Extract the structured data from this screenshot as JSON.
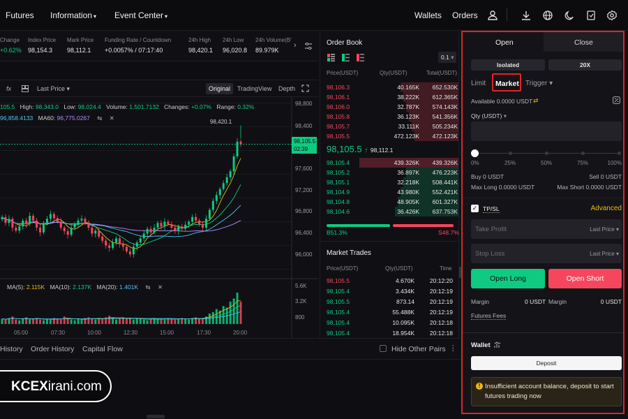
{
  "nav": {
    "futures": "Futures",
    "information": "Information",
    "event_center": "Event Center",
    "wallets": "Wallets",
    "orders": "Orders"
  },
  "ticker": {
    "change_label": "Change",
    "change_value": "+0.62%",
    "index_price_label": "Index Price",
    "index_price_value": "98,154.3",
    "mark_price_label": "Mark Price",
    "mark_price_value": "98,112.1",
    "funding_label": "Funding Rate / Countdown",
    "funding_value": "+0.0057% / 07:17:40",
    "high_label": "24h High",
    "high_value": "98,420.1",
    "low_label": "24h Low",
    "low_value": "96,020.8",
    "volume_label": "24h Volume(B'",
    "volume_value": "89.979K"
  },
  "chart_toolbar": {
    "last_price": "Last Price",
    "original": "Original",
    "tradingview": "TradingView",
    "depth": "Depth"
  },
  "chart_info": {
    "open_frag": "105.5",
    "high_label": "High:",
    "high": "98,343.0",
    "low_label": "Low:",
    "low": "98,024.4",
    "volume_label": "Volume:",
    "volume": "1,501.7132",
    "changes_label": "Changes:",
    "changes": "+0.07%",
    "range_label": "Range:",
    "range": "0.32%",
    "ma_frag": "96,858.4133",
    "ma60_label": "MA60:",
    "ma60": "96,775.0267",
    "peak_label": "98,420.1",
    "vol_ma5_label": "MA(5):",
    "vol_ma5": "2.115K",
    "vol_ma10_label": "MA(10):",
    "vol_ma10": "2.137K",
    "vol_ma20_label": "MA(20):",
    "vol_ma20": "1.401K",
    "current_price": "98,105.5",
    "countdown": "02:39"
  },
  "chart_data": {
    "type": "candlestick",
    "price_axis": [
      "98,800",
      "98,400",
      "98,000",
      "97,600",
      "97,200",
      "96,800",
      "96,400",
      "96,000"
    ],
    "volume_axis": [
      "5.6K",
      "3.2K",
      "800"
    ],
    "time_axis": [
      "05:00",
      "07:30",
      "10:00",
      "12:30",
      "15:00",
      "17:30",
      "20:00"
    ],
    "ylim": [
      95900,
      98900
    ],
    "close": [
      96880,
      96780,
      96850,
      96700,
      96650,
      96720,
      96820,
      96760,
      96900,
      96820,
      96700,
      96620,
      96780,
      96850,
      96930,
      96860,
      96800,
      96700,
      96640,
      96580,
      96700,
      96760,
      96820,
      96850,
      96780,
      96700,
      96600,
      96650,
      96550,
      96480,
      96400,
      96360,
      96450,
      96520,
      96420,
      96380,
      96300,
      96250,
      96380,
      96450,
      96520,
      96600,
      96680,
      96620,
      96700,
      96780,
      96720,
      96800,
      96760,
      96700,
      96650,
      96720,
      96680,
      96750,
      96800,
      96880,
      96820,
      96760,
      96700,
      96850,
      97000,
      97150,
      97250,
      97350,
      97450,
      97550,
      97650,
      97900,
      98150,
      98105
    ],
    "volume": [
      0.7,
      0.6,
      0.8,
      1.0,
      0.6,
      0.5,
      0.7,
      0.9,
      0.6,
      0.7,
      0.8,
      0.6,
      0.5,
      0.7,
      0.6,
      0.8,
      0.7,
      0.6,
      1.0,
      0.8,
      0.6,
      0.5,
      0.7,
      0.6,
      0.8,
      0.9,
      0.7,
      0.6,
      0.8,
      0.7,
      0.9,
      1.1,
      0.8,
      0.6,
      0.7,
      0.9,
      0.8,
      0.7,
      0.6,
      0.8,
      0.7,
      0.6,
      0.5,
      0.7,
      0.8,
      0.6,
      0.7,
      0.6,
      0.8,
      0.7,
      0.6,
      0.7,
      0.8,
      0.7,
      0.6,
      0.8,
      0.9,
      0.7,
      0.8,
      1.0,
      1.4,
      1.6,
      2.0,
      1.8,
      2.4,
      2.2,
      3.0,
      3.4,
      4.2,
      3.0
    ]
  },
  "order_book": {
    "title": "Order Book",
    "step": "0.1",
    "headers": [
      "Price(USDT)",
      "Qty(USDT)",
      "Total(USDT)"
    ],
    "asks": [
      {
        "price": "98,106.3",
        "qty": "40.165K",
        "total": "652.530K",
        "depth": 0.42
      },
      {
        "price": "98,106.1",
        "qty": "38.222K",
        "total": "612.365K",
        "depth": 0.4
      },
      {
        "price": "98,106.0",
        "qty": "32.787K",
        "total": "574.143K",
        "depth": 0.38
      },
      {
        "price": "98,105.8",
        "qty": "36.123K",
        "total": "541.356K",
        "depth": 0.36
      },
      {
        "price": "98,105.7",
        "qty": "33.111K",
        "total": "505.234K",
        "depth": 0.34
      },
      {
        "price": "98,105.5",
        "qty": "472.123K",
        "total": "472.123K",
        "depth": 0.32
      }
    ],
    "mid_price": "98,105.5",
    "mid_mark": "98,112.1",
    "bids": [
      {
        "price": "98,105.4",
        "qty": "439.326K",
        "total": "439.326K",
        "depth": 0.36
      },
      {
        "price": "98,105.2",
        "qty": "36.897K",
        "total": "476.223K",
        "depth": 0.38
      },
      {
        "price": "98,105.1",
        "qty": "32.218K",
        "total": "508.441K",
        "depth": 0.4
      },
      {
        "price": "98,104.9",
        "qty": "43.980K",
        "total": "552.421K",
        "depth": 0.42
      },
      {
        "price": "98,104.8",
        "qty": "48.905K",
        "total": "601.327K",
        "depth": 0.44
      },
      {
        "price": "98,104.6",
        "qty": "36.426K",
        "total": "637.753K",
        "depth": 0.46
      }
    ],
    "buy_ratio": "B51.3%",
    "sell_ratio": "S48.7%",
    "buy_fraction": 0.513
  },
  "market_trades": {
    "title": "Market Trades",
    "headers": [
      "Price(USDT)",
      "Qty(USDT)",
      "Time"
    ],
    "rows": [
      {
        "price": "98,105.5",
        "qty": "4.670K",
        "time": "20:12:20",
        "side": "sell"
      },
      {
        "price": "98,105.4",
        "qty": "3.434K",
        "time": "20:12:19",
        "side": "buy"
      },
      {
        "price": "98,105.5",
        "qty": "873.14",
        "time": "20:12:19",
        "side": "buy"
      },
      {
        "price": "98,105.4",
        "qty": "55.488K",
        "time": "20:12:19",
        "side": "buy"
      },
      {
        "price": "98,105.4",
        "qty": "10.095K",
        "time": "20:12:18",
        "side": "buy"
      },
      {
        "price": "98,105.4",
        "qty": "18.954K",
        "time": "20:12:18",
        "side": "buy"
      }
    ]
  },
  "bottom_tabs": {
    "history": "History",
    "order_history": "Order History",
    "capital_flow": "Capital Flow",
    "hide_other_pairs": "Hide Other Pairs"
  },
  "panel": {
    "tab_open": "Open",
    "tab_close": "Close",
    "margin_mode": "Isolated",
    "leverage": "20X",
    "limit": "Limit",
    "market": "Market",
    "trigger": "Trigger",
    "available": "Available 0.0000 USDT",
    "qty_label": "Qty (USDT)",
    "slider_marks": [
      "0%",
      "25%",
      "50%",
      "75%",
      "100%"
    ],
    "slider_value": 0,
    "buy": "Buy 0 USDT",
    "sell": "Sell 0 USDT",
    "max_long": "Max Long 0.0000 USDT",
    "max_short": "Max Short 0.0000 USDT",
    "tpsl": "TP/SL",
    "advanced": "Advanced",
    "take_profit": "Take Profit",
    "stop_loss": "Stop Loss",
    "last_price": "Last Price",
    "open_long": "Open Long",
    "open_short": "Open Short",
    "margin_label": "Margin",
    "margin_value": "0 USDT",
    "futures_fees": "Futures Fees",
    "wallet": "Wallet",
    "deposit": "Deposit",
    "warning": "Insufficient account balance, deposit to start futures trading now"
  },
  "watermark": {
    "brand": "KCEX",
    "suffix": "irani.com"
  },
  "colors": {
    "green": "#0ecb81",
    "red": "#f6465d",
    "highlight": "#e02424"
  }
}
